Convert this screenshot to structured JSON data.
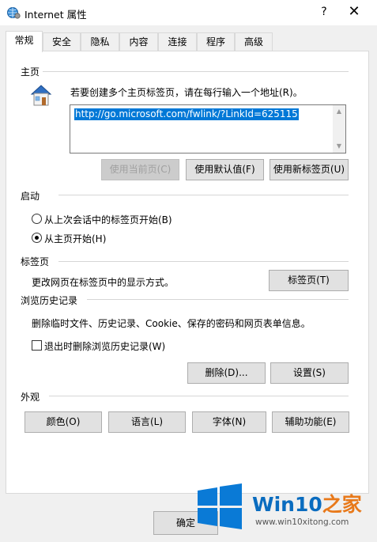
{
  "window": {
    "title": "Internet 属性",
    "help_glyph": "?",
    "close_glyph": "✕"
  },
  "tabs": [
    {
      "label": "常规",
      "active": true
    },
    {
      "label": "安全",
      "active": false
    },
    {
      "label": "隐私",
      "active": false
    },
    {
      "label": "内容",
      "active": false
    },
    {
      "label": "连接",
      "active": false
    },
    {
      "label": "程序",
      "active": false
    },
    {
      "label": "高级",
      "active": false
    }
  ],
  "homepage": {
    "section_title": "主页",
    "instruction": "若要创建多个主页标签页，请在每行输入一个地址(R)。",
    "url_value": "http://go.microsoft.com/fwlink/?LinkId=625115",
    "btn_use_current": "使用当前页(C)",
    "btn_use_default": "使用默认值(F)",
    "btn_use_new_tab": "使用新标签页(U)"
  },
  "startup": {
    "section_title": "启动",
    "option_last_session": "从上次会话中的标签页开始(B)",
    "option_homepage": "从主页开始(H)",
    "selected": "homepage"
  },
  "tabs_section": {
    "section_title": "标签页",
    "description": "更改网页在标签页中的显示方式。",
    "btn_tabs": "标签页(T)"
  },
  "history": {
    "section_title": "浏览历史记录",
    "description": "删除临时文件、历史记录、Cookie、保存的密码和网页表单信息。",
    "checkbox_delete_on_exit": "退出时删除浏览历史记录(W)",
    "checkbox_checked": false,
    "btn_delete": "删除(D)...",
    "btn_settings": "设置(S)"
  },
  "appearance": {
    "section_title": "外观",
    "btn_colors": "颜色(O)",
    "btn_languages": "语言(L)",
    "btn_fonts": "字体(N)",
    "btn_accessibility": "辅助功能(E)"
  },
  "footer": {
    "btn_ok": "确定"
  },
  "watermark": {
    "brand": "Win10",
    "brand_zh": "之家",
    "url": "www.win10xitong.com"
  },
  "colors": {
    "selection": "#0078d7",
    "brand_blue": "#0a6cbf",
    "brand_orange": "#e8791a"
  }
}
